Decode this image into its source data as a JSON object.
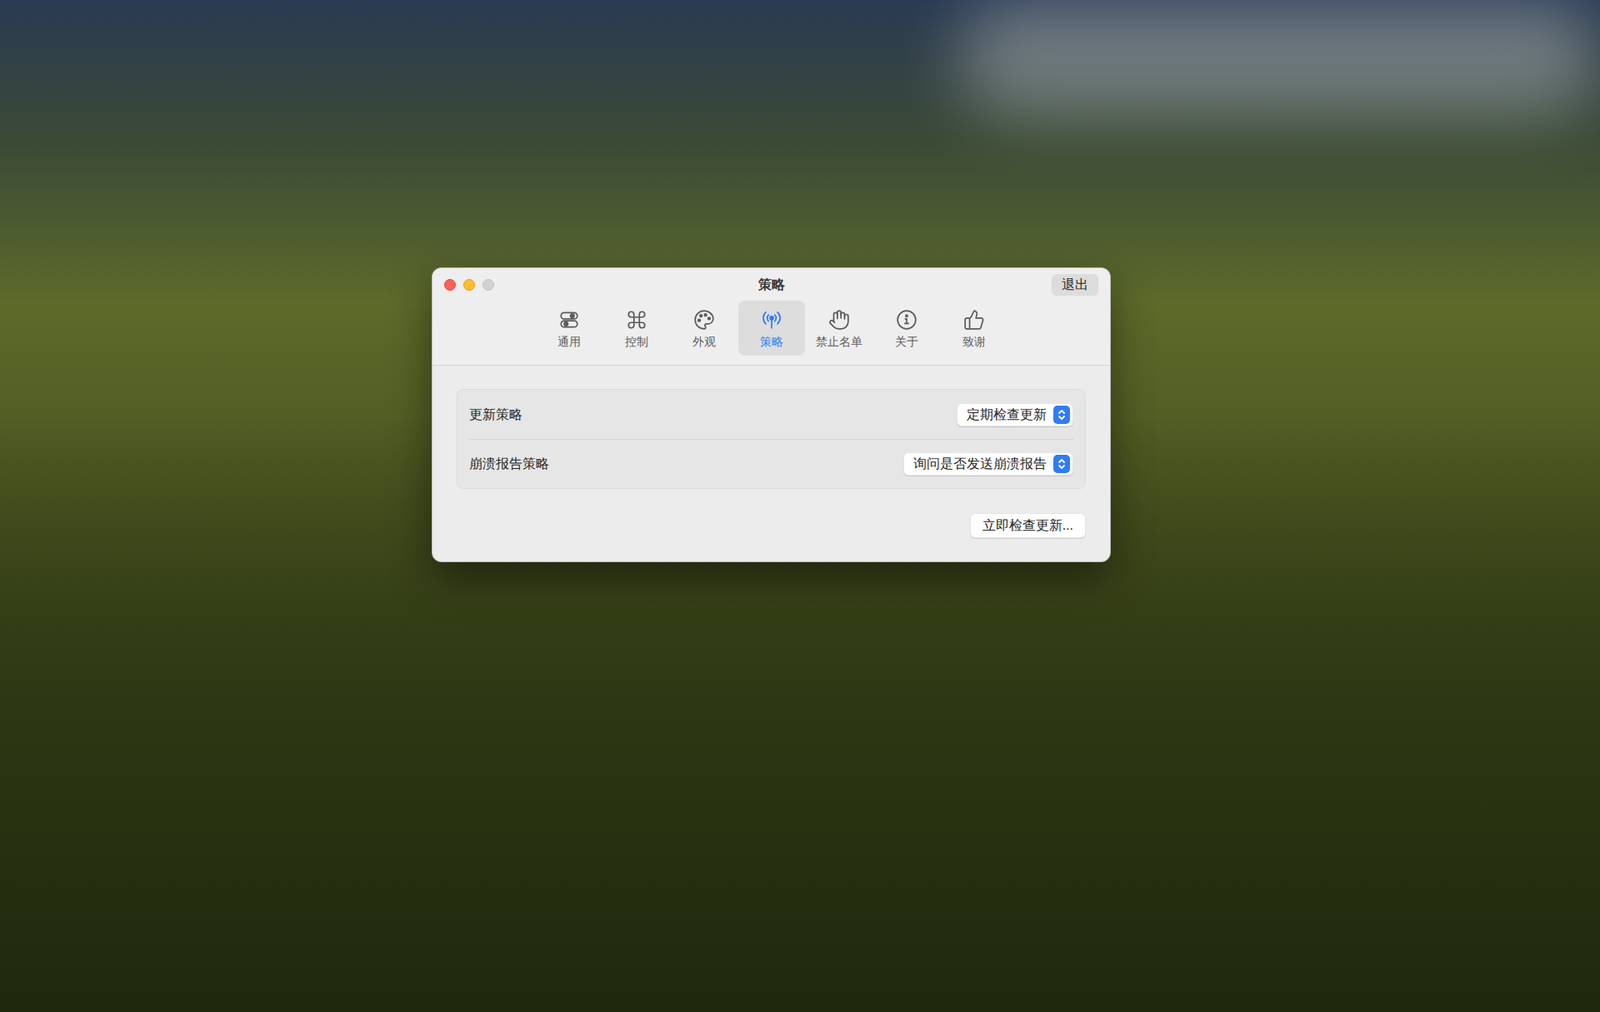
{
  "window": {
    "title": "策略",
    "controls": [
      {
        "kind": "close",
        "enabled": true
      },
      {
        "kind": "minimize",
        "enabled": true
      },
      {
        "kind": "zoom",
        "enabled": false
      }
    ],
    "quit_button": "退出"
  },
  "tabs": [
    {
      "label": "通用",
      "selected": false
    },
    {
      "label": "控制",
      "selected": false
    },
    {
      "label": "外观",
      "selected": false
    },
    {
      "label": "策略",
      "selected": true
    },
    {
      "label": "禁止名单",
      "selected": false
    },
    {
      "label": "关于",
      "selected": false
    },
    {
      "label": "致谢",
      "selected": false
    }
  ],
  "settings": [
    {
      "label": "更新策略",
      "value": "定期检查更新"
    },
    {
      "label": "崩溃报告策略",
      "value": "询问是否发送崩溃报告"
    }
  ],
  "buttons": [
    "立即检查更新..."
  ]
}
